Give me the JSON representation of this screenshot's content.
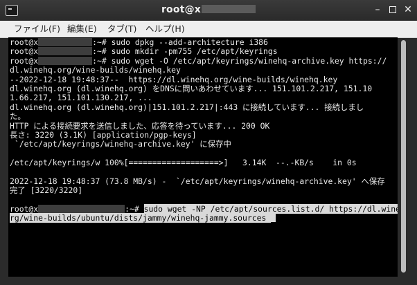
{
  "window": {
    "title_user": "root@x",
    "icon": "terminal-icon",
    "minimize_glyph": "–",
    "close_glyph": "✕"
  },
  "menubar": {
    "items": [
      {
        "label": "ファイル(F)"
      },
      {
        "label": "編集(E)"
      },
      {
        "label": "タブ(T)"
      },
      {
        "label": "ヘルプ(H)"
      }
    ]
  },
  "terminal": {
    "prompt_user": "root@x",
    "prompt_suffix": ":~# ",
    "commands": [
      "sudo dpkg --add-architecture i386",
      "sudo mkdir -pm755 /etc/apt/keyrings",
      "sudo wget -O /etc/apt/keyrings/winehq-archive.key https://"
    ],
    "output": [
      "dl.winehq.org/wine-builds/winehq.key",
      "--2022-12-18 19:48:37--  https://dl.winehq.org/wine-builds/winehq.key",
      "dl.winehq.org (dl.winehq.org) をDNSに問いあわせています... 151.101.2.217, 151.10",
      "1.66.217, 151.101.130.217, ...",
      "dl.winehq.org (dl.winehq.org)|151.101.2.217|:443 に接続しています... 接続しまし",
      "た。",
      "HTTP による接続要求を送信しました、応答を待っています... 200 OK",
      "長さ: 3220 (3.1K) [application/pgp-keys]",
      " `/etc/apt/keyrings/winehq-archive.key' に保存中",
      "/etc/apt/keyrings/w 100%[===================>]   3.14K  --.-KB/s    in 0s",
      "2022-12-18 19:48:37 (73.8 MB/s) -  `/etc/apt/keyrings/winehq-archive.key' へ保存",
      "完了 [3220/3220]"
    ],
    "final_command": [
      "sudo wget -NP /etc/apt/sources.list.d/ https://dl.winehq.o",
      "rg/wine-builds/ubuntu/dists/jammy/winehq-jammy.sources "
    ]
  },
  "colors": {
    "terminal_bg": "#000000",
    "terminal_fg": "#e8e8e8",
    "selection_bg": "#d9d9d9"
  }
}
